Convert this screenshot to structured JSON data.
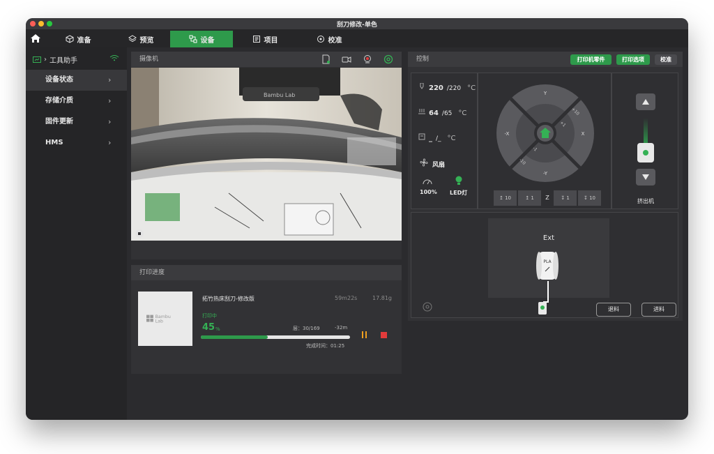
{
  "window": {
    "title": "刮刀修改-单色"
  },
  "nav": {
    "tabs": [
      {
        "label": "准备",
        "icon": "cube-icon"
      },
      {
        "label": "预览",
        "icon": "layers-icon"
      },
      {
        "label": "设备",
        "icon": "device-icon",
        "active": true
      },
      {
        "label": "项目",
        "icon": "project-icon"
      },
      {
        "label": "校准",
        "icon": "calibrate-icon"
      }
    ]
  },
  "sidebar": {
    "printer_name": "工具助手",
    "items": [
      {
        "label": "设备状态",
        "active": true
      },
      {
        "label": "存储介质"
      },
      {
        "label": "固件更新"
      },
      {
        "label": "HMS"
      }
    ]
  },
  "camera": {
    "title": "摄像机",
    "brand_text": "Bambu Lab"
  },
  "print": {
    "title": "打印进度",
    "thumb_logo_line1": "Bambu",
    "thumb_logo_line2": "Lab",
    "job_name": "拓竹热床刮刀-修改版",
    "total_time": "59m22s",
    "weight": "17.81g",
    "status": "打印中",
    "percent": "45",
    "percent_unit": "%",
    "progress": 0.45,
    "layer": "层：30/169",
    "remaining": "-32m",
    "finish_time": "完成时间：01:25"
  },
  "control": {
    "title": "控制",
    "btn_parts": "打印机零件",
    "btn_options": "打印选项",
    "btn_calibrate": "校准",
    "nozzle_cur": "220",
    "nozzle_tgt": "/220",
    "bed_cur": "64",
    "bed_tgt": "/65",
    "chamber_cur": "_",
    "chamber_tgt": "/_",
    "temp_unit": "°C",
    "fan_label": "风扇",
    "speed_label": "100%",
    "led_label": "LED灯",
    "jog": {
      "y_pos": "Y",
      "y_neg": "-Y",
      "x_pos": "X",
      "x_neg": "-X",
      "p10": "+10",
      "p1": "+1",
      "m1": "-1",
      "m10": "-10"
    },
    "z_label": "Z",
    "z_buttons": [
      "10",
      "1",
      "1",
      "10"
    ],
    "extruder_label": "挤出机",
    "ext_title": "Ext",
    "filament_type": "PLA",
    "unload_label": "退料",
    "load_label": "进料"
  },
  "colors": {
    "accent": "#2e9a4b",
    "progress_text": "#35b155",
    "stop": "#e23b3b",
    "pause": "#f0a020"
  }
}
